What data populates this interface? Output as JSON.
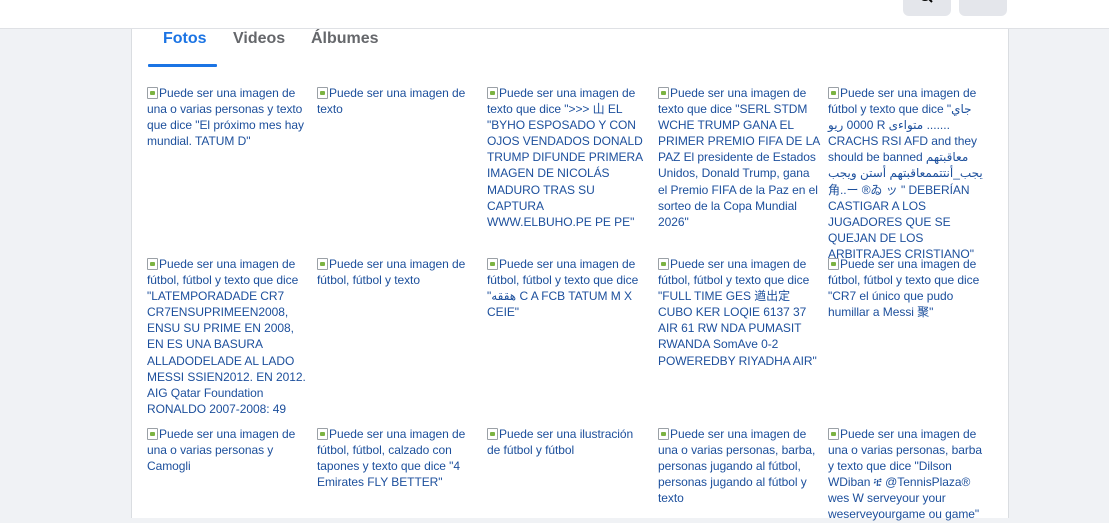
{
  "tabs": [
    {
      "label": "Fotos",
      "active": true
    },
    {
      "label": "Videos",
      "active": false
    },
    {
      "label": "Álbumes",
      "active": false
    }
  ],
  "colors": {
    "accent": "#1b74e4",
    "link": "#1c4f9c"
  },
  "icons": {
    "broken_image": "broken-image-icon",
    "search": "search-icon"
  },
  "photos": [
    {
      "alt": "Puede ser una imagen de una o varias personas y texto que dice \"El próximo mes hay mundial. TATUM D\""
    },
    {
      "alt": "Puede ser una imagen de texto"
    },
    {
      "alt": "Puede ser una imagen de texto que dice \">>> 山 EL \"BYHO ESPOSADO Y CON OJOS VENDADOS DONALD TRUMP DIFUNDE PRIMERA IMAGEN DE NICOLÁS MADURO TRAS SU CAPTURA WWW.ELBUHO.PE PE PE\""
    },
    {
      "alt": "Puede ser una imagen de texto que dice \"SERL STDM WCHE TRUMP GANA EL PRIMER PREMIO FIFA DE LA PAZ El presidente de Estados Unidos, Donald Trump, gana el Premio FIFA de la Paz en el sorteo de la Copa Mundial 2026\""
    },
    {
      "alt": "Puede ser una imagen de fútbol y texto que dice \"جاي 0000 ريو R متواءی ....... CRACHS RSI AFD and they should be banned معاقبتهم يجب_أنتتممعاقبتهم أستن ويجب 角..ー ®ゐ ッ \" DEBERÍAN CASTIGAR A LOS JUGADORES QUE SE QUEJAN DE LOS ARBITRAJES CRISTIANO\""
    },
    {
      "alt": "Puede ser una imagen de fútbol, fútbol y texto que dice \"LATEMPORADADE CR7 CR7ENSUPRIMEEN2008, ENSU SU PRIME EN 2008, EN ES UNA BASURA ALLADODELADE AL LADO MESSI SSIEN2012. EN 2012. AIG Qatar Foundation RONALDO 2007-2008: 49"
    },
    {
      "alt": "Puede ser una imagen de fútbol, fútbol y texto"
    },
    {
      "alt": "Puede ser una imagen de fútbol, fútbol y texto que dice \"هققه C A FCB TATUM M X CEIE\""
    },
    {
      "alt": "Puede ser una imagen de fútbol, fútbol y texto que dice \"FULL TIME GES 遒出定 CUBO KER LOQIE 6137 37 AIR 61 RW NDA PUMASIT RWANDA SomAve 0-2 POWEREDBY RIYADHA AIR\""
    },
    {
      "alt": "Puede ser una imagen de fútbol, fútbol y texto que dice \"CR7 el único que pudo humillar a Messi 聚\""
    },
    {
      "alt": "Puede ser una imagen de una o varias personas y Camogli"
    },
    {
      "alt": "Puede ser una imagen de fútbol, fútbol, calzado con tapones y texto que dice \"4 Emirates FLY BETTER\""
    },
    {
      "alt": "Puede ser una ilustración de fútbol y fútbol"
    },
    {
      "alt": "Puede ser una imagen de una o varias personas, barba, personas jugando al fútbol, personas jugando al fútbol y texto"
    },
    {
      "alt": "Puede ser una imagen de una o varias personas, barba y texto que dice \"Dilson WDiban ቼ @TennisPlaza® wes W serveyour your weserveyourgame ou game\""
    }
  ]
}
